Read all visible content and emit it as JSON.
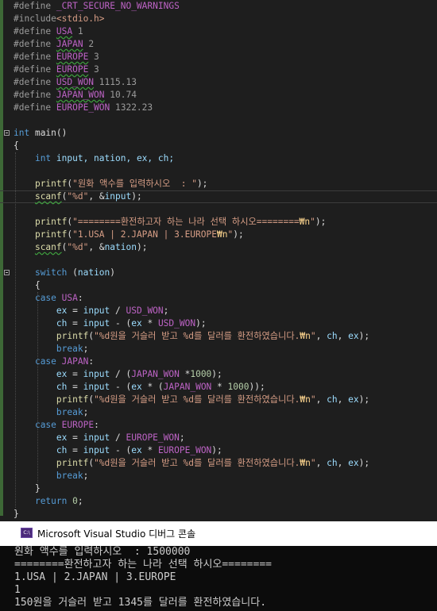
{
  "editor": {
    "lines": [
      [
        {
          "t": "#define",
          "c": "pp"
        },
        {
          "t": " _CRT_SECURE_NO_WARNINGS",
          "c": "mac"
        }
      ],
      [
        {
          "t": "#include",
          "c": "pp"
        },
        {
          "t": "<stdio.h>",
          "c": "inc"
        }
      ],
      [
        {
          "t": "#define ",
          "c": "pp"
        },
        {
          "t": "USA",
          "c": "mac squig"
        },
        {
          "t": " 1",
          "c": "pp"
        }
      ],
      [
        {
          "t": "#define ",
          "c": "pp"
        },
        {
          "t": "JAPAN",
          "c": "mac squig"
        },
        {
          "t": " 2",
          "c": "pp"
        }
      ],
      [
        {
          "t": "#define ",
          "c": "pp"
        },
        {
          "t": "EUROPE",
          "c": "mac squig"
        },
        {
          "t": " 3",
          "c": "pp"
        }
      ],
      [
        {
          "t": "#define ",
          "c": "pp"
        },
        {
          "t": "EUROPE",
          "c": "mac squig"
        },
        {
          "t": " 3",
          "c": "pp"
        }
      ],
      [
        {
          "t": "#define ",
          "c": "pp"
        },
        {
          "t": "USD_WON",
          "c": "mac squig"
        },
        {
          "t": " 1115.13",
          "c": "pp"
        }
      ],
      [
        {
          "t": "#define ",
          "c": "pp"
        },
        {
          "t": "JAPAN_WON",
          "c": "mac squig"
        },
        {
          "t": " 10.74",
          "c": "pp"
        }
      ],
      [
        {
          "t": "#define ",
          "c": "pp"
        },
        {
          "t": "EUROPE_WON",
          "c": "mac"
        },
        {
          "t": " 1322.23",
          "c": "pp"
        }
      ],
      [],
      [
        {
          "t": "int",
          "c": "kw"
        },
        {
          "t": " main()"
        }
      ],
      [
        {
          "t": "{"
        }
      ],
      [
        {
          "t": "    "
        },
        {
          "t": "int",
          "c": "kw"
        },
        {
          "t": " input, nation, ex, ch;",
          "c": "var"
        }
      ],
      [],
      [
        {
          "t": "    "
        },
        {
          "t": "printf",
          "c": "fn"
        },
        {
          "t": "("
        },
        {
          "t": "\"원화 액수를 입력하시오  : \"",
          "c": "str"
        },
        {
          "t": ");"
        }
      ],
      [
        {
          "t": "    "
        },
        {
          "t": "scanf",
          "c": "fn squig"
        },
        {
          "t": "("
        },
        {
          "t": "\"%d\"",
          "c": "str"
        },
        {
          "t": ", &"
        },
        {
          "t": "input",
          "c": "var"
        },
        {
          "t": ");"
        }
      ],
      [],
      [
        {
          "t": "    "
        },
        {
          "t": "printf",
          "c": "fn"
        },
        {
          "t": "("
        },
        {
          "t": "\"========환전하고자 하는 나라 선택 하시오========",
          "c": "str"
        },
        {
          "t": "₩n",
          "c": "esc"
        },
        {
          "t": "\"",
          "c": "str"
        },
        {
          "t": ");"
        }
      ],
      [
        {
          "t": "    "
        },
        {
          "t": "printf",
          "c": "fn"
        },
        {
          "t": "("
        },
        {
          "t": "\"1.USA | 2.JAPAN | 3.EUROPE",
          "c": "str"
        },
        {
          "t": "₩n",
          "c": "esc"
        },
        {
          "t": "\"",
          "c": "str"
        },
        {
          "t": ");"
        }
      ],
      [
        {
          "t": "    "
        },
        {
          "t": "scanf",
          "c": "fn squig"
        },
        {
          "t": "("
        },
        {
          "t": "\"%d\"",
          "c": "str"
        },
        {
          "t": ", &"
        },
        {
          "t": "nation",
          "c": "var"
        },
        {
          "t": ");"
        }
      ],
      [],
      [
        {
          "t": "    "
        },
        {
          "t": "switch",
          "c": "kw"
        },
        {
          "t": " ("
        },
        {
          "t": "nation",
          "c": "var"
        },
        {
          "t": ")"
        }
      ],
      [
        {
          "t": "    {"
        }
      ],
      [
        {
          "t": "    "
        },
        {
          "t": "case",
          "c": "kw"
        },
        {
          "t": " "
        },
        {
          "t": "USA",
          "c": "mac"
        },
        {
          "t": ":"
        }
      ],
      [
        {
          "t": "        "
        },
        {
          "t": "ex",
          "c": "var"
        },
        {
          "t": " = "
        },
        {
          "t": "input",
          "c": "var"
        },
        {
          "t": " / "
        },
        {
          "t": "USD_WON",
          "c": "mac"
        },
        {
          "t": ";"
        }
      ],
      [
        {
          "t": "        "
        },
        {
          "t": "ch",
          "c": "var"
        },
        {
          "t": " = "
        },
        {
          "t": "input",
          "c": "var"
        },
        {
          "t": " - ("
        },
        {
          "t": "ex",
          "c": "var"
        },
        {
          "t": " * "
        },
        {
          "t": "USD_WON",
          "c": "mac"
        },
        {
          "t": ");"
        }
      ],
      [
        {
          "t": "        "
        },
        {
          "t": "printf",
          "c": "fn"
        },
        {
          "t": "("
        },
        {
          "t": "\"%d원을 거슬러 받고 %d를 달러를 환전하였습니다.",
          "c": "str"
        },
        {
          "t": "₩n",
          "c": "esc"
        },
        {
          "t": "\"",
          "c": "str"
        },
        {
          "t": ", "
        },
        {
          "t": "ch",
          "c": "var"
        },
        {
          "t": ", "
        },
        {
          "t": "ex",
          "c": "var"
        },
        {
          "t": ");"
        }
      ],
      [
        {
          "t": "        "
        },
        {
          "t": "break",
          "c": "kw"
        },
        {
          "t": ";"
        }
      ],
      [
        {
          "t": "    "
        },
        {
          "t": "case",
          "c": "kw"
        },
        {
          "t": " "
        },
        {
          "t": "JAPAN",
          "c": "mac"
        },
        {
          "t": ":"
        }
      ],
      [
        {
          "t": "        "
        },
        {
          "t": "ex",
          "c": "var"
        },
        {
          "t": " = "
        },
        {
          "t": "input",
          "c": "var"
        },
        {
          "t": " / ("
        },
        {
          "t": "JAPAN_WON",
          "c": "mac"
        },
        {
          "t": " *"
        },
        {
          "t": "1000",
          "c": "num"
        },
        {
          "t": ");"
        }
      ],
      [
        {
          "t": "        "
        },
        {
          "t": "ch",
          "c": "var"
        },
        {
          "t": " = "
        },
        {
          "t": "input",
          "c": "var"
        },
        {
          "t": " - ("
        },
        {
          "t": "ex",
          "c": "var"
        },
        {
          "t": " * ("
        },
        {
          "t": "JAPAN_WON",
          "c": "mac"
        },
        {
          "t": " * "
        },
        {
          "t": "1000",
          "c": "num"
        },
        {
          "t": "));"
        }
      ],
      [
        {
          "t": "        "
        },
        {
          "t": "printf",
          "c": "fn"
        },
        {
          "t": "("
        },
        {
          "t": "\"%d원을 거슬러 받고 %d를 달러를 환전하였습니다.",
          "c": "str"
        },
        {
          "t": "₩n",
          "c": "esc"
        },
        {
          "t": "\"",
          "c": "str"
        },
        {
          "t": ", "
        },
        {
          "t": "ch",
          "c": "var"
        },
        {
          "t": ", "
        },
        {
          "t": "ex",
          "c": "var"
        },
        {
          "t": ");"
        }
      ],
      [
        {
          "t": "        "
        },
        {
          "t": "break",
          "c": "kw"
        },
        {
          "t": ";"
        }
      ],
      [
        {
          "t": "    "
        },
        {
          "t": "case",
          "c": "kw"
        },
        {
          "t": " "
        },
        {
          "t": "EUROPE",
          "c": "mac"
        },
        {
          "t": ":"
        }
      ],
      [
        {
          "t": "        "
        },
        {
          "t": "ex",
          "c": "var"
        },
        {
          "t": " = "
        },
        {
          "t": "input",
          "c": "var"
        },
        {
          "t": " / "
        },
        {
          "t": "EUROPE_WON",
          "c": "mac"
        },
        {
          "t": ";"
        }
      ],
      [
        {
          "t": "        "
        },
        {
          "t": "ch",
          "c": "var"
        },
        {
          "t": " = "
        },
        {
          "t": "input",
          "c": "var"
        },
        {
          "t": " - ("
        },
        {
          "t": "ex",
          "c": "var"
        },
        {
          "t": " * "
        },
        {
          "t": "EUROPE_WON",
          "c": "mac"
        },
        {
          "t": ");"
        }
      ],
      [
        {
          "t": "        "
        },
        {
          "t": "printf",
          "c": "fn"
        },
        {
          "t": "("
        },
        {
          "t": "\"%d원을 거슬러 받고 %d를 달러를 환전하였습니다.",
          "c": "str"
        },
        {
          "t": "₩n",
          "c": "esc"
        },
        {
          "t": "\"",
          "c": "str"
        },
        {
          "t": ", "
        },
        {
          "t": "ch",
          "c": "var"
        },
        {
          "t": ", "
        },
        {
          "t": "ex",
          "c": "var"
        },
        {
          "t": ");"
        }
      ],
      [
        {
          "t": "        "
        },
        {
          "t": "break",
          "c": "kw"
        },
        {
          "t": ";"
        }
      ],
      [
        {
          "t": "    }"
        }
      ],
      [
        {
          "t": "    "
        },
        {
          "t": "return",
          "c": "kw"
        },
        {
          "t": " "
        },
        {
          "t": "0",
          "c": "num"
        },
        {
          "t": ";"
        }
      ],
      [
        {
          "t": "}"
        }
      ]
    ],
    "current_line": 15,
    "fold_lines": [
      10,
      21
    ]
  },
  "console": {
    "title": "Microsoft Visual Studio 디버그 콘솔",
    "icon": "console-app-icon",
    "icon_label": "C:\\",
    "lines": [
      "원화 액수를 입력하시오  : 1500000",
      "========환전하고자 하는 나라 선택 하시오========",
      "1.USA | 2.JAPAN | 3.EUROPE",
      "1",
      "150원을 거슬러 받고 1345를 달러를 환전하였습니다."
    ]
  },
  "colors": {
    "editor_bg": "#1e1e1e",
    "keyword": "#569cd6",
    "macro": "#bd63c5",
    "string": "#d69d85",
    "function": "#dcdcaa",
    "variable": "#9cdcfe",
    "console_bg": "#0c0c0c"
  }
}
